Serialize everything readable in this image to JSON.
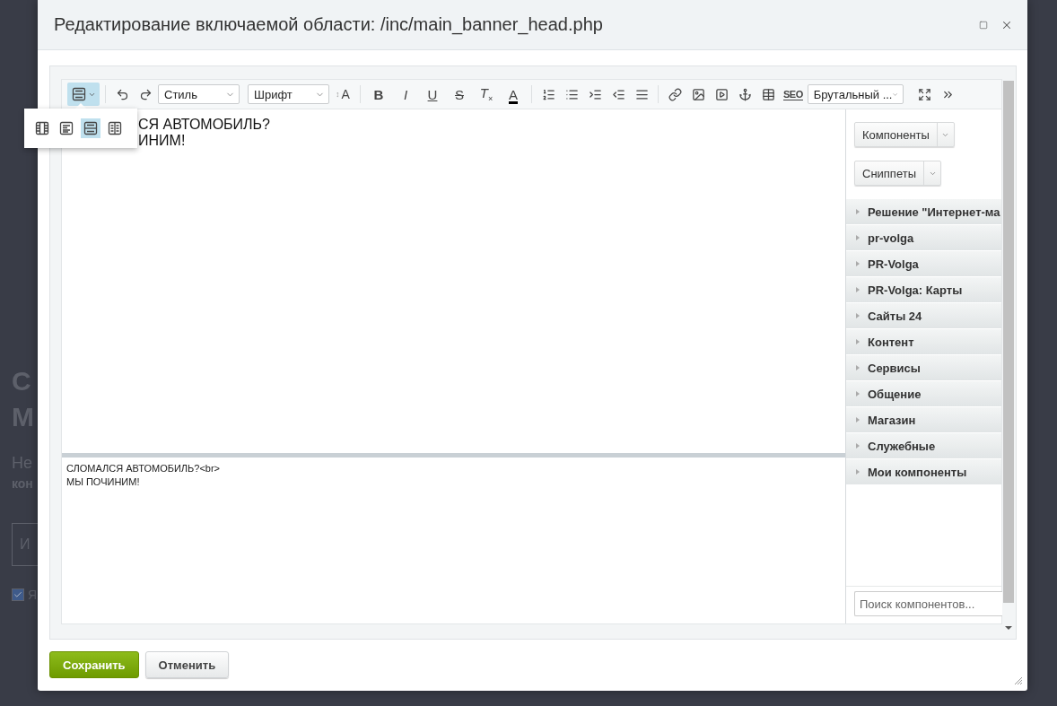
{
  "background_page": {
    "heading_lines": [
      "С",
      "М"
    ],
    "text_lines": [
      "Не",
      "кон"
    ],
    "input_value": "И",
    "consent": {
      "checked": true,
      "label": "Я"
    }
  },
  "dialog": {
    "title": "Редактирование включаемой области: /inc/main_banner_head.php"
  },
  "toolbar": {
    "view_button": {
      "expanded": true
    },
    "view_modes": [
      {
        "selected": false
      },
      {
        "selected": false
      },
      {
        "selected": true
      },
      {
        "selected": false
      }
    ],
    "style_select": "Стиль",
    "font_select": "Шрифт",
    "size_arrow": "↕",
    "size_glyph": "A",
    "format_buttons": [
      {
        "kind": "bold",
        "glyph": "B"
      },
      {
        "kind": "italic",
        "glyph": "I"
      },
      {
        "kind": "underline",
        "glyph": "U"
      },
      {
        "kind": "strike",
        "glyph": "S"
      },
      {
        "kind": "clear",
        "glyph": "T",
        "sub": "×"
      },
      {
        "kind": "color",
        "glyph": "A"
      }
    ],
    "seo_label": "SEO",
    "template_select": "Брутальный ..."
  },
  "editor": {
    "visual_lines": [
      "СЯ АВТОМОБИЛЬ?",
      "ИНИМ!"
    ],
    "code_lines": [
      "СЛОМАЛСЯ АВТОМОБИЛЬ?<br>",
      "МЫ ПОЧИНИМ!"
    ]
  },
  "components_panel": {
    "buttons": [
      "Компоненты",
      "Сниппеты"
    ],
    "groups": [
      {
        "label": "Решение \"Интернет-ма",
        "expanded": false
      },
      {
        "label": "pr-volga",
        "expanded": false
      },
      {
        "label": "PR-Volga",
        "expanded": false
      },
      {
        "label": "PR-Volga: Карты",
        "expanded": false
      },
      {
        "label": "Сайты 24",
        "expanded": false
      },
      {
        "label": "Контент",
        "expanded": false
      },
      {
        "label": "Сервисы",
        "expanded": false
      },
      {
        "label": "Общение",
        "expanded": false
      },
      {
        "label": "Магазин",
        "expanded": false
      },
      {
        "label": "Служебные",
        "expanded": false
      },
      {
        "label": "Мои компоненты",
        "expanded": false
      }
    ],
    "search": {
      "placeholder": "Поиск компонентов..."
    }
  },
  "buttons": [
    {
      "kind": "primary",
      "label": "Сохранить"
    },
    {
      "kind": "secondary",
      "label": "Отменить"
    }
  ]
}
